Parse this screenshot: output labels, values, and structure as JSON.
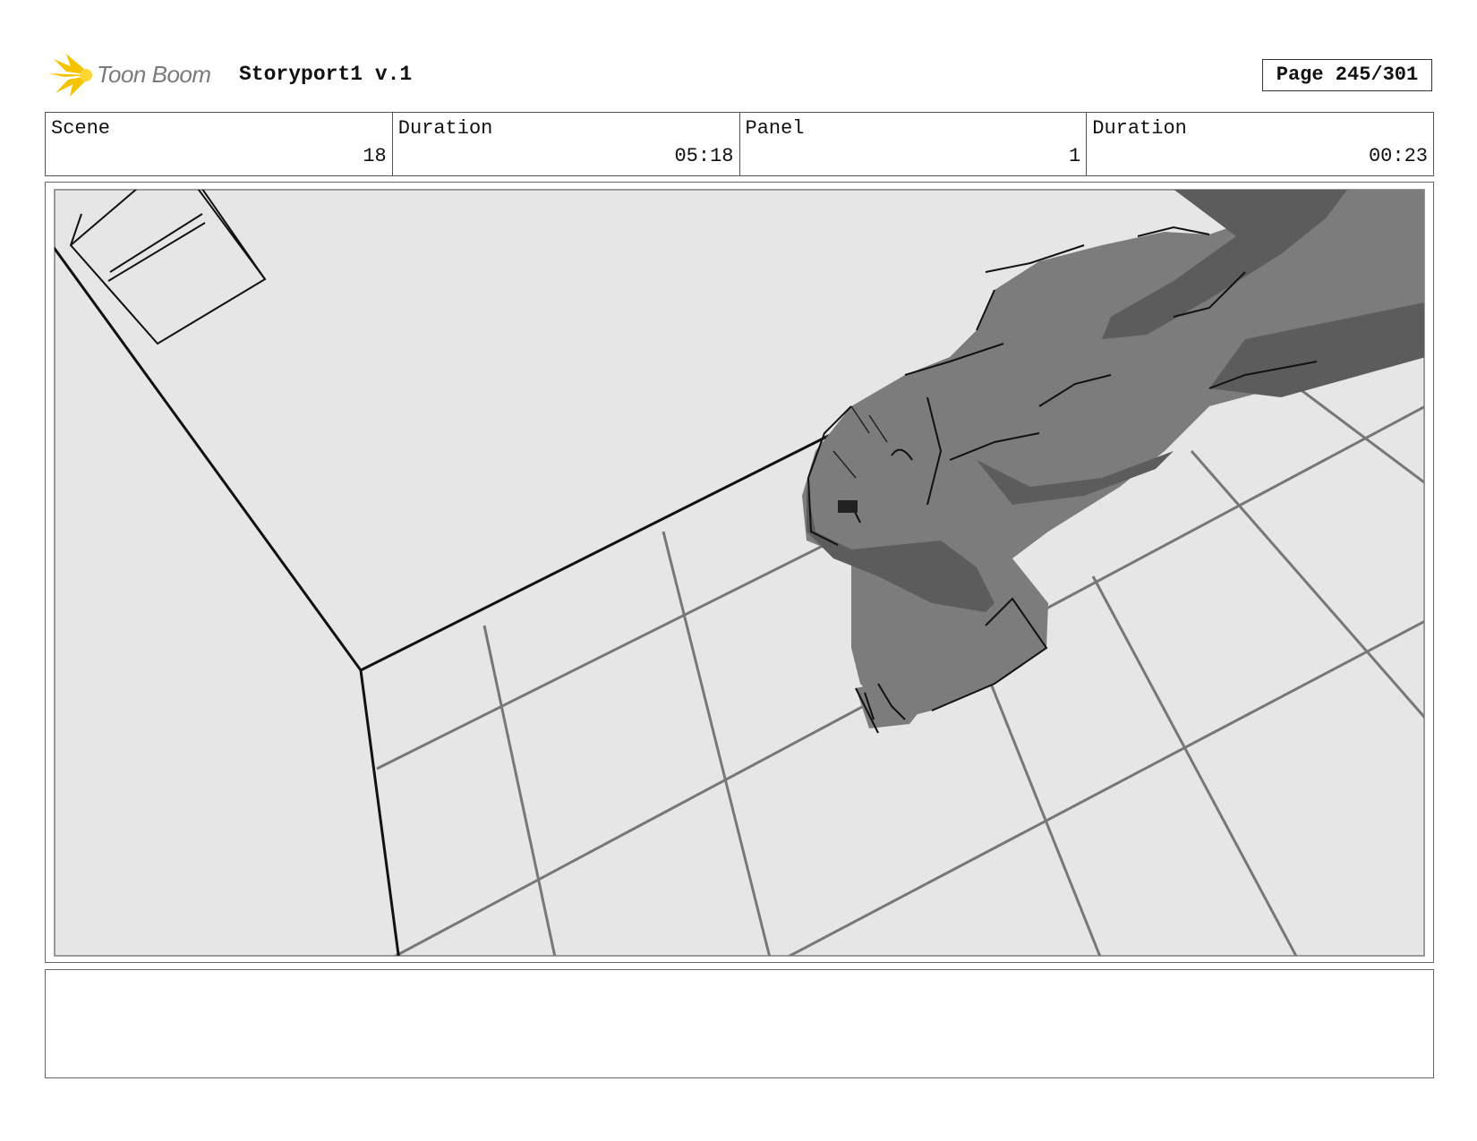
{
  "header": {
    "logo_text": "Toon Boom",
    "project_title": "Storyport1 v.1",
    "page_label": "Page 245/301"
  },
  "info": {
    "scene_label": "Scene",
    "scene_value": "18",
    "scene_duration_label": "Duration",
    "scene_duration_value": "05:18",
    "panel_label": "Panel",
    "panel_value": "1",
    "panel_duration_label": "Duration",
    "panel_duration_value": "00:23"
  },
  "panel": {
    "drawing": "sketch-figure-lying-on-tiled-floor"
  },
  "notes": {
    "text": ""
  },
  "colors": {
    "logo_accent": "#f5c400",
    "figure_fill": "#7c7c7c",
    "figure_shadow": "#5c5c5c",
    "background_fill": "#e6e6e6"
  }
}
